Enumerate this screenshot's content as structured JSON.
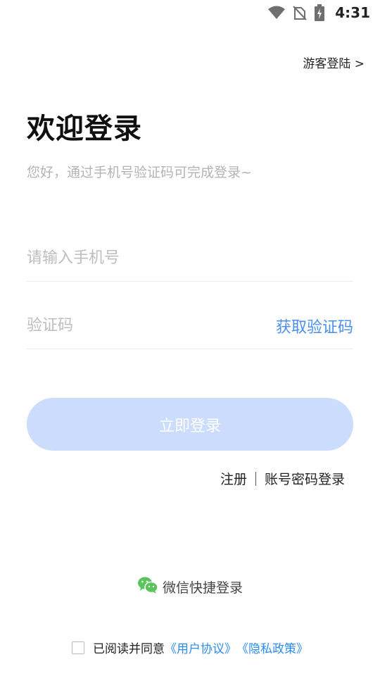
{
  "status_bar": {
    "time": "4:31",
    "icons": [
      "wifi-icon",
      "no-sim-icon",
      "battery-charging-icon"
    ]
  },
  "header": {
    "guest_login": "游客登陆 >"
  },
  "main": {
    "title": "欢迎登录",
    "subtitle": "您好，通过手机号验证码可完成登录~",
    "phone_field": {
      "placeholder": "请输入手机号",
      "value": ""
    },
    "code_field": {
      "placeholder": "验证码",
      "value": ""
    },
    "get_code_label": "获取验证码",
    "login_button": "立即登录",
    "register_link": "注册",
    "password_login_link": "账号密码登录"
  },
  "footer": {
    "wechat_login": "微信快捷登录",
    "agreement_prefix": "已阅读并同意",
    "user_agreement": "《用户协议》",
    "privacy_policy": "《隐私政策》",
    "agreement_checked": false
  },
  "colors": {
    "accent": "#4a8ff0",
    "login_button_bg": "#cbdcfd",
    "link_blue": "#2d8cf0",
    "wechat_green": "#5ac35a"
  }
}
